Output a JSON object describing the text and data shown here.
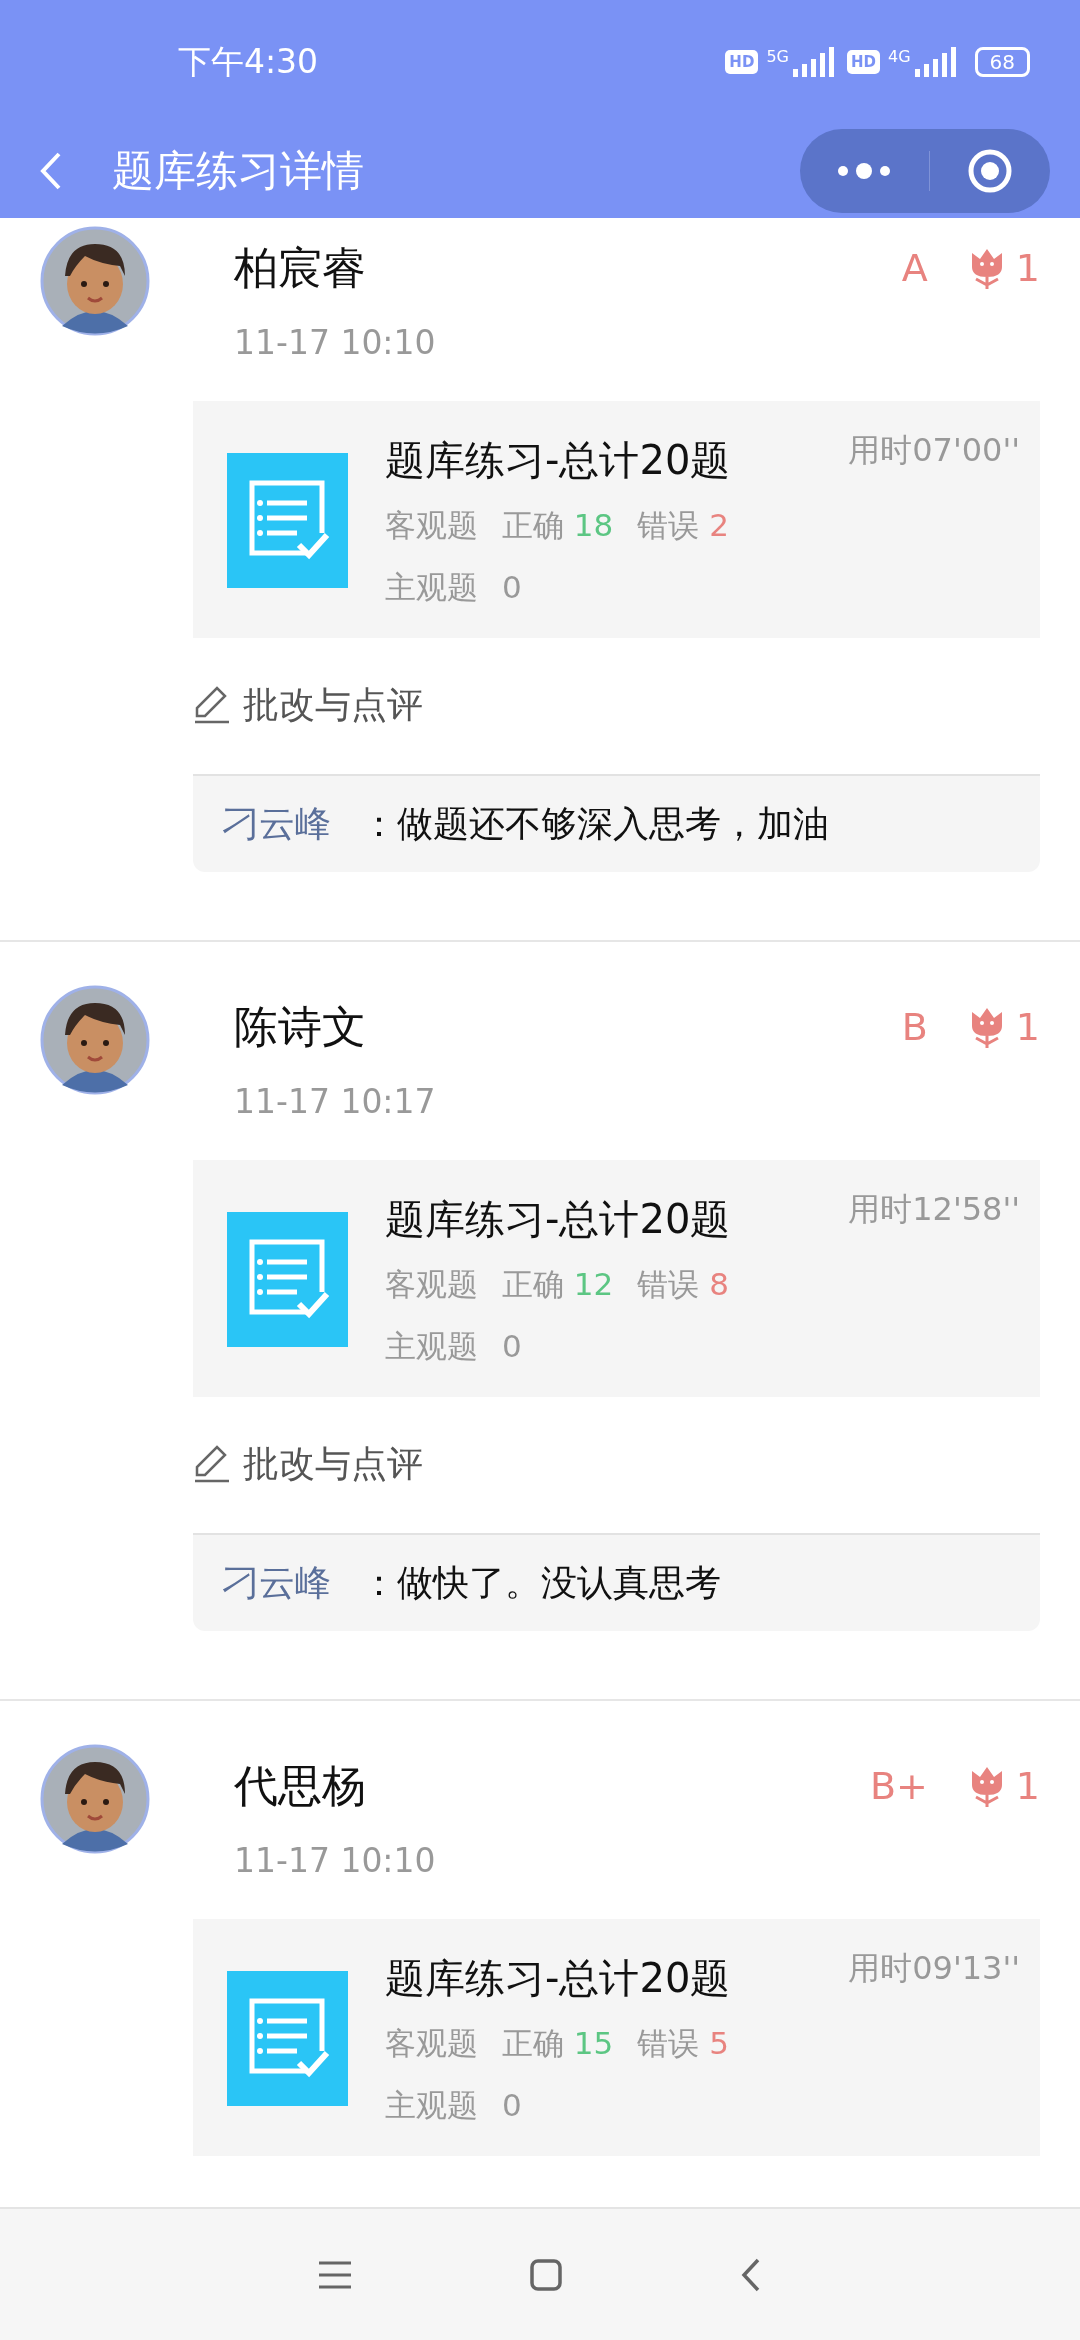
{
  "status_bar": {
    "time": "下午4:30",
    "hd_1": "HD",
    "network_1": "5G",
    "hd_2": "HD",
    "network_2": "4G",
    "battery": "68"
  },
  "header": {
    "title": "题库练习详情"
  },
  "entries": [
    {
      "name": "柏宸睿",
      "time": "11-17 10:10",
      "grade": "A",
      "flowers": "1",
      "practice": {
        "title": "题库练习-总计20题",
        "duration": "用时07'00''",
        "objective_label": "客观题",
        "correct_label": "正确",
        "correct": "18",
        "wrong_label": "错误",
        "wrong": "2",
        "subjective_label": "主观题",
        "subjective": "0"
      },
      "review_label": "批改与点评",
      "comment": {
        "teacher": "刁云峰",
        "text": "：做题还不够深入思考，加油"
      }
    },
    {
      "name": "陈诗文",
      "time": "11-17 10:17",
      "grade": "B",
      "flowers": "1",
      "practice": {
        "title": "题库练习-总计20题",
        "duration": "用时12'58''",
        "objective_label": "客观题",
        "correct_label": "正确",
        "correct": "12",
        "wrong_label": "错误",
        "wrong": "8",
        "subjective_label": "主观题",
        "subjective": "0"
      },
      "review_label": "批改与点评",
      "comment": {
        "teacher": "刁云峰",
        "text": "：做快了。没认真思考"
      }
    },
    {
      "name": "代思杨",
      "time": "11-17 10:10",
      "grade": "B+",
      "flowers": "1",
      "practice": {
        "title": "题库练习-总计20题",
        "duration": "用时09'13''",
        "objective_label": "客观题",
        "correct_label": "正确",
        "correct": "15",
        "wrong_label": "错误",
        "wrong": "5",
        "subjective_label": "主观题",
        "subjective": "0"
      }
    }
  ]
}
